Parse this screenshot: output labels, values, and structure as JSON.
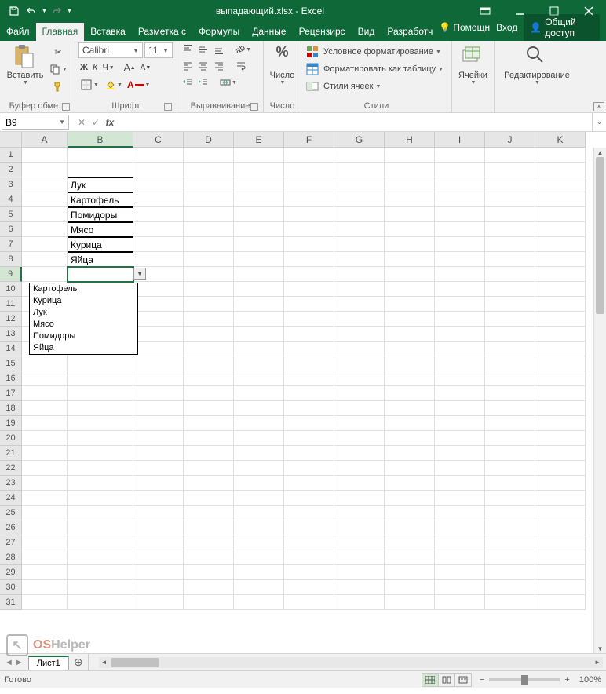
{
  "title": "выпадающий.xlsx - Excel",
  "tabs": [
    "Файл",
    "Главная",
    "Вставка",
    "Разметка с",
    "Формулы",
    "Данные",
    "Рецензирс",
    "Вид",
    "Разработч"
  ],
  "active_tab": 1,
  "help_label": "Помощн",
  "signin_label": "Вход",
  "share_label": "Общий доступ",
  "ribbon": {
    "clipboard": {
      "paste": "Вставить",
      "label": "Буфер обме..."
    },
    "font": {
      "name": "Calibri",
      "size": "11",
      "label": "Шрифт"
    },
    "align": {
      "label": "Выравнивание"
    },
    "number": {
      "big": "Число",
      "label": "Число"
    },
    "styles": {
      "cf": "Условное форматирование",
      "fat": "Форматировать как таблицу",
      "cs": "Стили ячеек",
      "label": "Стили"
    },
    "cells": {
      "big": "Ячейки"
    },
    "editing": {
      "big": "Редактирование"
    }
  },
  "namebox": "B9",
  "columns": [
    "A",
    "B",
    "C",
    "D",
    "E",
    "F",
    "G",
    "H",
    "I",
    "J",
    "K"
  ],
  "row_count": 31,
  "active_row": 9,
  "active_col": "B",
  "col_widths": {
    "A": 58,
    "B": 84,
    "default": 64
  },
  "cells": {
    "B3": "Лук",
    "B4": "Картофель",
    "B5": "Помидоры",
    "B6": "Мясо",
    "B7": "Курица",
    "B8": "Яйца"
  },
  "bordered": [
    "B3",
    "B4",
    "B5",
    "B6",
    "B7",
    "B8"
  ],
  "dropdown_options": [
    "Картофель",
    "Курица",
    "Лук",
    "Мясо",
    "Помидоры",
    "Яйца"
  ],
  "sheet_tab": "Лист1",
  "status_ready": "Готово",
  "zoom": "100%",
  "watermark": {
    "r": "OS",
    "g": "Helper"
  }
}
